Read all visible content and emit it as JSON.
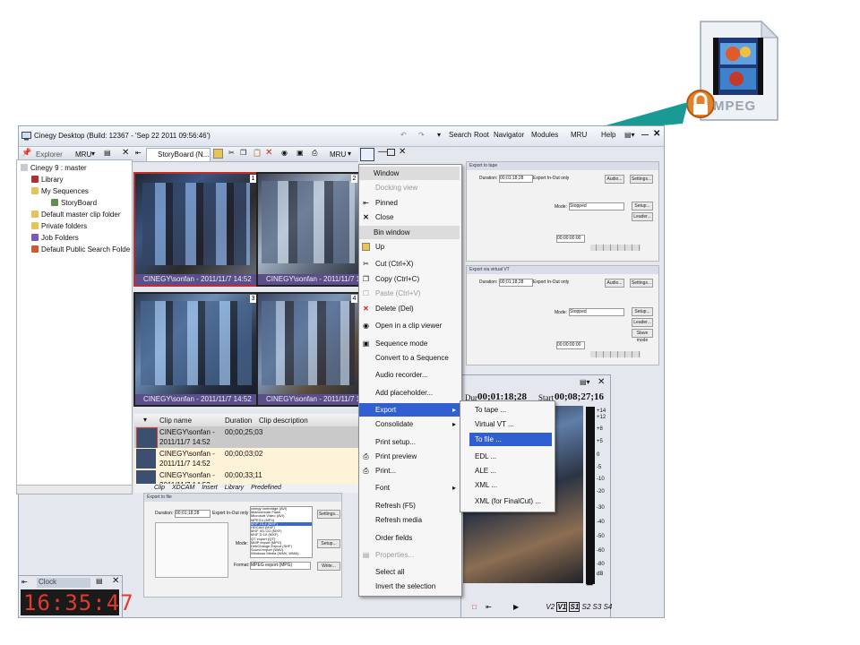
{
  "window": {
    "title": "Cinegy Desktop (Build: 12367 - 'Sep 22 2011 09:56:46')"
  },
  "topbar": {
    "search": "Search",
    "root": "Root",
    "navigator": "Navigator",
    "modules": "Modules",
    "mru": "MRU",
    "help": "Help"
  },
  "explorer": {
    "tab": "Explorer",
    "mru": "MRU",
    "items": [
      "Cinegy 9 : master",
      "Library",
      "My Sequences",
      "StoryBoard",
      "Default master clip folder",
      "Private folders",
      "Job Folders",
      "Default Public Search Folde"
    ]
  },
  "storyboard": {
    "tab": "StoryBoard (N...",
    "mru": "MRU",
    "thumbs": [
      {
        "caption": "CINEGY\\sonfan - 2011/11/7 14:52",
        "num": "1"
      },
      {
        "caption": "CINEGY\\sonfan - 2011/11/7 14:52",
        "num": "2"
      },
      {
        "caption": "CINEGY\\sonfan - 2011/11/7 14:52",
        "num": "3"
      },
      {
        "caption": "CINEGY\\sonfan - 2011/11/7 14:52",
        "num": "4"
      }
    ],
    "columns": [
      "Clip name",
      "Duration",
      "Clip description"
    ],
    "rows": [
      {
        "name": "CINEGY\\sonfan - 2011/11/7 14:52",
        "duration": "00;00;25;03"
      },
      {
        "name": "CINEGY\\sonfan - 2011/11/7 14:52",
        "duration": "00;00;03;02"
      },
      {
        "name": "CINEGY\\sonfan - 2011/11/7 14:52",
        "duration": "00;00;33;11"
      }
    ],
    "tabs": [
      "Clip",
      "XDCAM",
      "Insert",
      "Library",
      "Predefined"
    ]
  },
  "context_menu": {
    "items": [
      {
        "label": "Window",
        "type": "header"
      },
      {
        "label": "Docking view",
        "disabled": true
      },
      {
        "label": "Pinned",
        "icon": "pin-icon"
      },
      {
        "label": "Close",
        "icon": "close-icon"
      },
      {
        "label": "Bin window",
        "type": "header"
      },
      {
        "label": "Up",
        "icon": "up-folder-icon"
      },
      {
        "label": "Cut (Ctrl+X)",
        "icon": "scissors-icon"
      },
      {
        "label": "Copy (Ctrl+C)",
        "icon": "copy-icon"
      },
      {
        "label": "Paste (Ctrl+V)",
        "icon": "paste-icon",
        "disabled": true
      },
      {
        "label": "Delete (Del)",
        "icon": "delete-icon"
      },
      {
        "label": "Open in a clip viewer",
        "icon": "viewer-icon"
      },
      {
        "label": "Sequence mode",
        "icon": "sequence-icon"
      },
      {
        "label": "Convert to a Sequence"
      },
      {
        "label": "Audio recorder..."
      },
      {
        "label": "Add placeholder..."
      },
      {
        "label": "Export",
        "selected": true,
        "submenu": true
      },
      {
        "label": "Consolidate",
        "submenu": true
      },
      {
        "label": "Print setup..."
      },
      {
        "label": "Print preview",
        "icon": "print-preview-icon"
      },
      {
        "label": "Print...",
        "icon": "print-icon"
      },
      {
        "label": "Font",
        "submenu": true
      },
      {
        "label": "Refresh (F5)"
      },
      {
        "label": "Refresh media"
      },
      {
        "label": "Order fields"
      },
      {
        "label": "Properties...",
        "icon": "properties-icon",
        "disabled": true
      },
      {
        "label": "Select all"
      },
      {
        "label": "Invert the selection"
      }
    ]
  },
  "export_submenu": {
    "items": [
      {
        "label": "To tape ..."
      },
      {
        "label": "Virtual VT ..."
      },
      {
        "label": "To file ...",
        "selected": true
      },
      {
        "label": "EDL ..."
      },
      {
        "label": "ALE ..."
      },
      {
        "label": "XML ..."
      },
      {
        "label": "XML (for FinalCut) ..."
      }
    ]
  },
  "dialogs": {
    "tape": {
      "title": "Export to tape",
      "duration_label": "Duration:",
      "duration": "00;01;18;28",
      "export_label": "Export In-Out only",
      "audio": "Audio...",
      "settings": "Settings...",
      "mode_label": "Mode:",
      "mode": "Stopped",
      "setup": "Setup...",
      "leader": "Leader...",
      "tc": "00:00:00:00"
    },
    "vt": {
      "title": "Export via virtual VT",
      "duration_label": "Duration:",
      "duration": "00;01;18;28",
      "export_label": "Export In-Out only",
      "audio": "Audio...",
      "settings": "Settings...",
      "mode_label": "Mode:",
      "mode": "Stopped",
      "setup": "Setup...",
      "leader": "Leader...",
      "slave": "Slave mode",
      "tc": "00:00:00:00"
    },
    "file": {
      "title": "Export to file",
      "duration_label": "Duration:",
      "duration": "00;01;18;28",
      "export_label": "Export In-Out only",
      "settings": "Settings...",
      "mode_label": "Mode:",
      "setup": "Setup...",
      "format_label": "Format:",
      "format": "MPEG export (MPG)",
      "write": "Write...",
      "formats": [
        "cinegy onebridge (AVI)",
        "Matroxmode Flash",
        "Microsoft Video (AVI)",
        "MPEG4 (MP4)",
        "MXF 10-4 (MXF)",
        "HDCAM (MXF)",
        "MXF XD-CD (MXF)",
        "MXF D-10 (MXF)",
        "QT export (QT)",
        "MMP export (MPG)",
        "DebChange Export (SHF)",
        "Sound export (WAV)",
        "Windows Media (WMV, WMA)"
      ]
    }
  },
  "viewer": {
    "dur_label": "Dur",
    "dur": "00;01:18;28",
    "start_label": "Start",
    "start": "00;08;27;16",
    "tracks": [
      "V2",
      "V1",
      "S1",
      "S2",
      "S3",
      "S4"
    ],
    "meter_ticks": [
      "+14",
      "+12",
      "+8",
      "+5",
      "0",
      "-5",
      "-10",
      "-20",
      "-30",
      "-40",
      "-50",
      "-60",
      "-80",
      "dB"
    ]
  },
  "clock": {
    "title": "Clock",
    "time": "16:35:47",
    "color": "#e23a2b"
  },
  "file_icon": {
    "label": "MPEG"
  }
}
